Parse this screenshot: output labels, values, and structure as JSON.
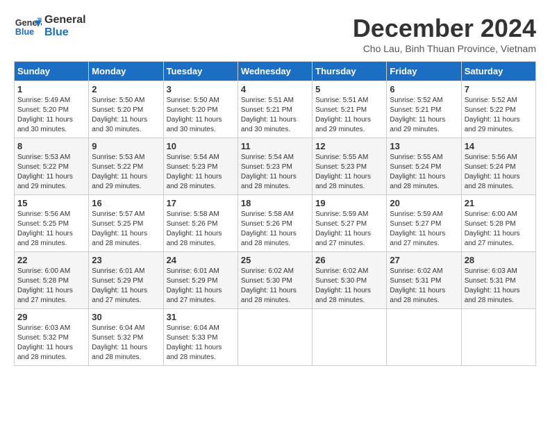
{
  "header": {
    "logo_line1": "General",
    "logo_line2": "Blue",
    "month": "December 2024",
    "location": "Cho Lau, Binh Thuan Province, Vietnam"
  },
  "weekdays": [
    "Sunday",
    "Monday",
    "Tuesday",
    "Wednesday",
    "Thursday",
    "Friday",
    "Saturday"
  ],
  "weeks": [
    [
      {
        "day": "1",
        "rise": "5:49 AM",
        "set": "5:20 PM",
        "daylight": "11 hours and 30 minutes."
      },
      {
        "day": "2",
        "rise": "5:50 AM",
        "set": "5:20 PM",
        "daylight": "11 hours and 30 minutes."
      },
      {
        "day": "3",
        "rise": "5:50 AM",
        "set": "5:20 PM",
        "daylight": "11 hours and 30 minutes."
      },
      {
        "day": "4",
        "rise": "5:51 AM",
        "set": "5:21 PM",
        "daylight": "11 hours and 30 minutes."
      },
      {
        "day": "5",
        "rise": "5:51 AM",
        "set": "5:21 PM",
        "daylight": "11 hours and 29 minutes."
      },
      {
        "day": "6",
        "rise": "5:52 AM",
        "set": "5:21 PM",
        "daylight": "11 hours and 29 minutes."
      },
      {
        "day": "7",
        "rise": "5:52 AM",
        "set": "5:22 PM",
        "daylight": "11 hours and 29 minutes."
      }
    ],
    [
      {
        "day": "8",
        "rise": "5:53 AM",
        "set": "5:22 PM",
        "daylight": "11 hours and 29 minutes."
      },
      {
        "day": "9",
        "rise": "5:53 AM",
        "set": "5:22 PM",
        "daylight": "11 hours and 29 minutes."
      },
      {
        "day": "10",
        "rise": "5:54 AM",
        "set": "5:23 PM",
        "daylight": "11 hours and 28 minutes."
      },
      {
        "day": "11",
        "rise": "5:54 AM",
        "set": "5:23 PM",
        "daylight": "11 hours and 28 minutes."
      },
      {
        "day": "12",
        "rise": "5:55 AM",
        "set": "5:23 PM",
        "daylight": "11 hours and 28 minutes."
      },
      {
        "day": "13",
        "rise": "5:55 AM",
        "set": "5:24 PM",
        "daylight": "11 hours and 28 minutes."
      },
      {
        "day": "14",
        "rise": "5:56 AM",
        "set": "5:24 PM",
        "daylight": "11 hours and 28 minutes."
      }
    ],
    [
      {
        "day": "15",
        "rise": "5:56 AM",
        "set": "5:25 PM",
        "daylight": "11 hours and 28 minutes."
      },
      {
        "day": "16",
        "rise": "5:57 AM",
        "set": "5:25 PM",
        "daylight": "11 hours and 28 minutes."
      },
      {
        "day": "17",
        "rise": "5:58 AM",
        "set": "5:26 PM",
        "daylight": "11 hours and 28 minutes."
      },
      {
        "day": "18",
        "rise": "5:58 AM",
        "set": "5:26 PM",
        "daylight": "11 hours and 28 minutes."
      },
      {
        "day": "19",
        "rise": "5:59 AM",
        "set": "5:27 PM",
        "daylight": "11 hours and 27 minutes."
      },
      {
        "day": "20",
        "rise": "5:59 AM",
        "set": "5:27 PM",
        "daylight": "11 hours and 27 minutes."
      },
      {
        "day": "21",
        "rise": "6:00 AM",
        "set": "5:28 PM",
        "daylight": "11 hours and 27 minutes."
      }
    ],
    [
      {
        "day": "22",
        "rise": "6:00 AM",
        "set": "5:28 PM",
        "daylight": "11 hours and 27 minutes."
      },
      {
        "day": "23",
        "rise": "6:01 AM",
        "set": "5:29 PM",
        "daylight": "11 hours and 27 minutes."
      },
      {
        "day": "24",
        "rise": "6:01 AM",
        "set": "5:29 PM",
        "daylight": "11 hours and 27 minutes."
      },
      {
        "day": "25",
        "rise": "6:02 AM",
        "set": "5:30 PM",
        "daylight": "11 hours and 28 minutes."
      },
      {
        "day": "26",
        "rise": "6:02 AM",
        "set": "5:30 PM",
        "daylight": "11 hours and 28 minutes."
      },
      {
        "day": "27",
        "rise": "6:02 AM",
        "set": "5:31 PM",
        "daylight": "11 hours and 28 minutes."
      },
      {
        "day": "28",
        "rise": "6:03 AM",
        "set": "5:31 PM",
        "daylight": "11 hours and 28 minutes."
      }
    ],
    [
      {
        "day": "29",
        "rise": "6:03 AM",
        "set": "5:32 PM",
        "daylight": "11 hours and 28 minutes."
      },
      {
        "day": "30",
        "rise": "6:04 AM",
        "set": "5:32 PM",
        "daylight": "11 hours and 28 minutes."
      },
      {
        "day": "31",
        "rise": "6:04 AM",
        "set": "5:33 PM",
        "daylight": "11 hours and 28 minutes."
      },
      null,
      null,
      null,
      null
    ]
  ]
}
